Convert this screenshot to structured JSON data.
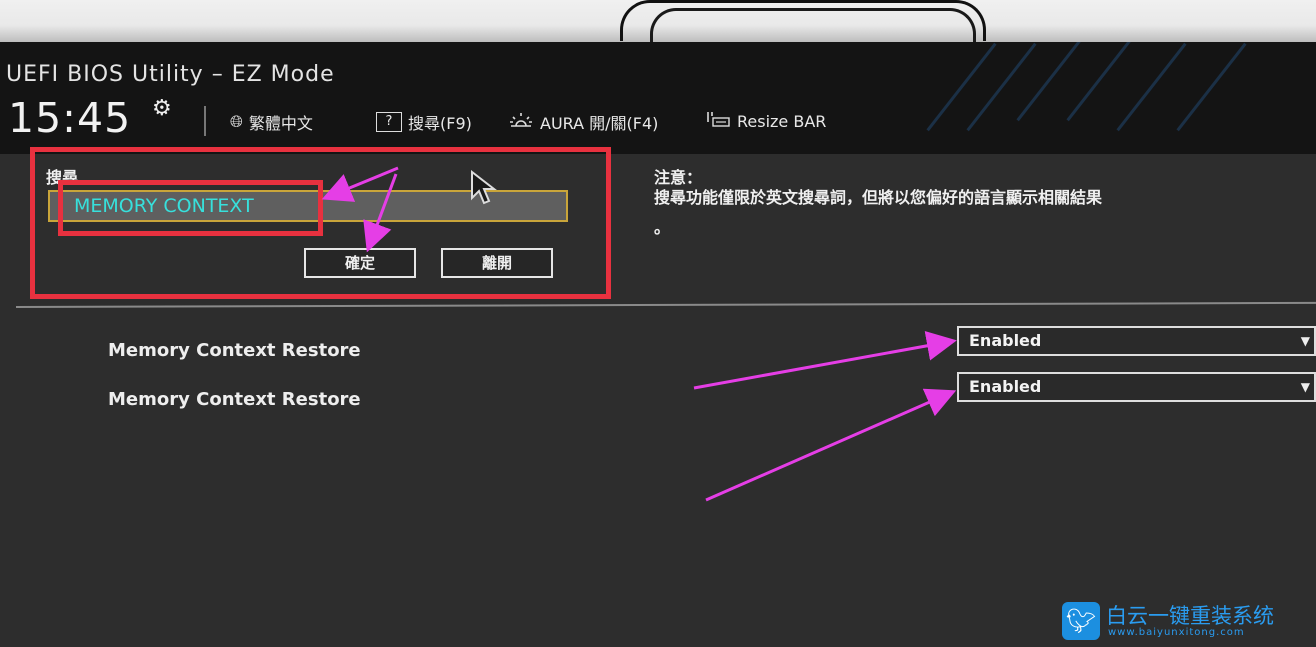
{
  "header": {
    "title": "UEFI BIOS Utility – EZ Mode",
    "time": "15:45",
    "language": "繁體中文",
    "search": "搜尋(F9)",
    "search_icon_text": "?",
    "aura": "AURA 開/關(F4)",
    "resize_bar": "Resize BAR"
  },
  "search_dialog": {
    "label": "搜尋",
    "value": "MEMORY CONTEXT",
    "confirm_label": "確定",
    "leave_label": "離開"
  },
  "note": {
    "title": "注意：",
    "text": "搜尋功能僅限於英文搜尋詞，但將以您偏好的語言顯示相關結果",
    "dot": "。"
  },
  "results": [
    {
      "label": "Memory Context Restore",
      "value": "Enabled"
    },
    {
      "label": "Memory Context Restore",
      "value": "Enabled"
    }
  ],
  "colors": {
    "annotation_red": "#e8313f",
    "arrow_magenta": "#e53ee6",
    "search_text": "#37e0dc",
    "field_border": "#c9a53a"
  },
  "watermark": {
    "name": "白云一键重装系统",
    "url": "www.baiyunxitong.com"
  }
}
